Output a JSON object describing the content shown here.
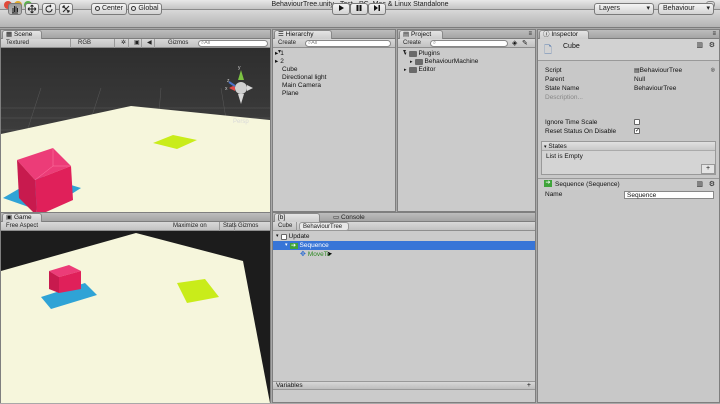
{
  "window": {
    "title": "BehaviourTree.unity - Test - PC, Mac & Linux Standalone"
  },
  "toolbar": {
    "pivot": "Center",
    "space": "Global",
    "layers": "Layers",
    "layout": "Behaviour"
  },
  "scene": {
    "tab": "Scene",
    "shading": "Textured",
    "render": "RGB",
    "gizmos": "Gizmos",
    "search": "All",
    "projection": "Persp",
    "gizmo_axes": {
      "x": "x",
      "y": "y",
      "z": "z"
    }
  },
  "game": {
    "tab": "Game",
    "aspect": "Free Aspect",
    "maximize": "Maximize on Play",
    "stats": "Stats",
    "gizmos": "Gizmos",
    "search": "All"
  },
  "hierarchy": {
    "tab": "Hierarchy",
    "create": "Create",
    "search": "All",
    "items": [
      "1",
      "2",
      "Cube",
      "Directional light",
      "Main Camera",
      "Plane"
    ]
  },
  "project": {
    "tab": "Project",
    "create": "Create",
    "items": [
      "Plugins",
      "BehaviourMachine",
      "Editor"
    ]
  },
  "behaviour": {
    "tab": "[b] Behaviour",
    "console_tab": "Console",
    "breadcrumb": [
      "Cube",
      "BehaviourTree"
    ],
    "nodes": [
      "Update",
      "Sequence",
      "MoveTo"
    ],
    "footer": "Variables",
    "add": "+"
  },
  "inspector": {
    "tab": "Inspector",
    "object_name": "Cube",
    "fields": [
      {
        "label": "Script",
        "value": "BehaviourTree"
      },
      {
        "label": "Parent",
        "value": "Null"
      },
      {
        "label": "State Name",
        "value": "BehaviourTree"
      },
      {
        "label": "Description...",
        "value": ""
      }
    ],
    "ignore_time_scale": "Ignore Time Scale",
    "reset_status": "Reset Status On Disable",
    "states_header": "States",
    "states_empty": "List is Empty",
    "states_add": "+",
    "component_title": "Sequence (Sequence)",
    "name_label": "Name",
    "name_value": "Sequence"
  },
  "colors": {
    "selection": "#3875d7",
    "floor": "#f6f6dc",
    "cube": "#e0205a",
    "shadow": "#2fa3d6",
    "target": "#c9ec1a"
  }
}
